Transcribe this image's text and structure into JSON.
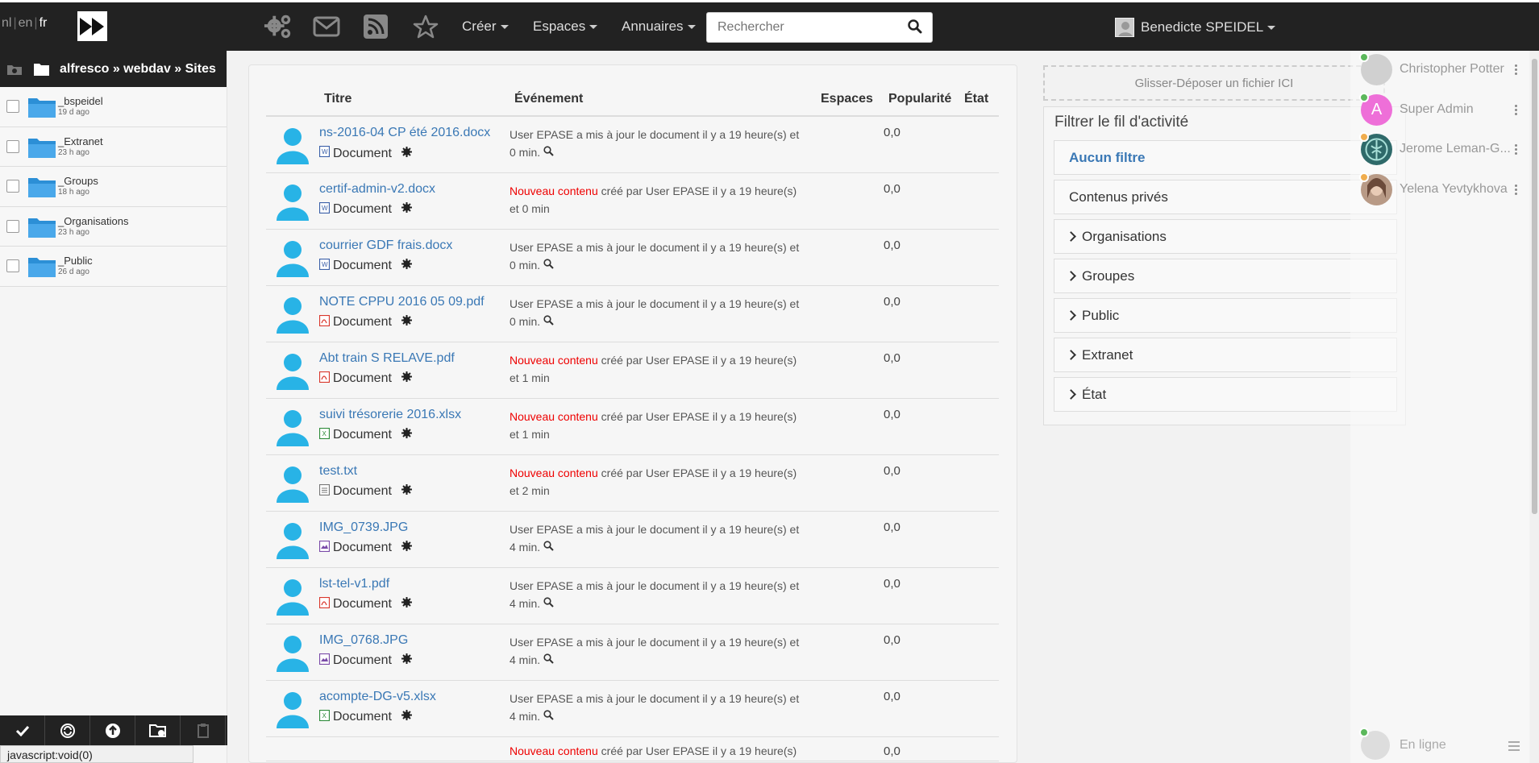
{
  "topbar": {
    "languages": [
      "nl",
      "en",
      "fr"
    ],
    "active_language": "fr",
    "menus": [
      {
        "label": "Créer"
      },
      {
        "label": "Espaces"
      },
      {
        "label": "Annuaires"
      }
    ],
    "search_placeholder": "Rechercher",
    "user_name": "Benedicte SPEIDEL"
  },
  "sidebar": {
    "breadcrumb": "alfresco » webdav » Sites",
    "folders": [
      {
        "name": "_bspeidel",
        "ago": "19 d ago"
      },
      {
        "name": "_Extranet",
        "ago": "23 h ago"
      },
      {
        "name": "_Groups",
        "ago": "18 h ago"
      },
      {
        "name": "_Organisations",
        "ago": "23 h ago"
      },
      {
        "name": "_Public",
        "ago": "26 d ago"
      }
    ],
    "status_text": "javascript:void(0)"
  },
  "activity": {
    "headers": {
      "title": "Titre",
      "event": "Événement",
      "spaces": "Espaces",
      "popularity": "Popularité",
      "state": "État"
    },
    "doc_label": "Document",
    "rows": [
      {
        "title": "ns-2016-04 CP été 2016.docx",
        "filetype": "word",
        "new": false,
        "event": "User EPASE a mis à jour le document il y a 19 heure(s) et 0 min.",
        "pop": "0,0"
      },
      {
        "title": "certif-admin-v2.docx",
        "filetype": "word",
        "new": true,
        "new_label": "Nouveau contenu",
        "event": " créé par User EPASE il y a 19 heure(s) et 0 min",
        "pop": "0,0"
      },
      {
        "title": "courrier GDF frais.docx",
        "filetype": "word",
        "new": false,
        "event": "User EPASE a mis à jour le document il y a 19 heure(s) et 0 min.",
        "pop": "0,0"
      },
      {
        "title": "NOTE CPPU 2016 05 09.pdf",
        "filetype": "pdf",
        "new": false,
        "event": "User EPASE a mis à jour le document il y a 19 heure(s) et 0 min.",
        "pop": "0,0"
      },
      {
        "title": "Abt train S RELAVE.pdf",
        "filetype": "pdf",
        "new": true,
        "new_label": "Nouveau contenu",
        "event": " créé par User EPASE il y a 19 heure(s) et 1 min",
        "pop": "0,0"
      },
      {
        "title": "suivi trésorerie 2016.xlsx",
        "filetype": "excel",
        "new": true,
        "new_label": "Nouveau contenu",
        "event": " créé par User EPASE il y a 19 heure(s) et 1 min",
        "pop": "0,0"
      },
      {
        "title": "test.txt",
        "filetype": "text",
        "new": true,
        "new_label": "Nouveau contenu",
        "event": " créé par User EPASE il y a 19 heure(s) et 2 min",
        "pop": "0,0"
      },
      {
        "title": "IMG_0739.JPG",
        "filetype": "image",
        "new": false,
        "event": "User EPASE a mis à jour le document il y a 19 heure(s) et 4 min.",
        "pop": "0,0"
      },
      {
        "title": "lst-tel-v1.pdf",
        "filetype": "pdf",
        "new": false,
        "event": "User EPASE a mis à jour le document il y a 19 heure(s) et 4 min.",
        "pop": "0,0"
      },
      {
        "title": "IMG_0768.JPG",
        "filetype": "image",
        "new": false,
        "event": "User EPASE a mis à jour le document il y a 19 heure(s) et 4 min.",
        "pop": "0,0"
      },
      {
        "title": "acompte-DG-v5.xlsx",
        "filetype": "excel",
        "new": false,
        "event": "User EPASE a mis à jour le document il y a 19 heure(s) et 4 min.",
        "pop": "0,0"
      },
      {
        "title": "",
        "filetype": "none",
        "new": true,
        "new_label": "Nouveau contenu",
        "event": " créé par User EPASE il y a 19 heure(s)",
        "pop": "0,0"
      }
    ]
  },
  "filters": {
    "dropzone": "Glisser-Déposer un fichier ICI",
    "heading": "Filtrer le fil d'activité",
    "items": [
      {
        "label": "Aucun filtre",
        "active": true,
        "expandable": false
      },
      {
        "label": "Contenus privés",
        "active": false,
        "expandable": false
      },
      {
        "label": "Organisations",
        "active": false,
        "expandable": true
      },
      {
        "label": "Groupes",
        "active": false,
        "expandable": true
      },
      {
        "label": "Public",
        "active": false,
        "expandable": true
      },
      {
        "label": "Extranet",
        "active": false,
        "expandable": true
      },
      {
        "label": "État",
        "active": false,
        "expandable": true
      }
    ]
  },
  "chat": {
    "contacts": [
      {
        "name": "Christopher Potter",
        "status_color": "#5cb85c",
        "avatar": "gray"
      },
      {
        "name": "Super Admin",
        "status_color": "#5cb85c",
        "avatar": "letter",
        "letter": "A"
      },
      {
        "name": "Jerome Leman-G...",
        "status_color": "#f0ad4e",
        "avatar": "emblem"
      },
      {
        "name": "Yelena Yevtykhova",
        "status_color": "#f0ad4e",
        "avatar": "photo"
      }
    ],
    "footer_status": "En ligne"
  },
  "colors": {
    "link": "#3a78b5",
    "new_content": "#e00000",
    "topbar": "#222222"
  }
}
